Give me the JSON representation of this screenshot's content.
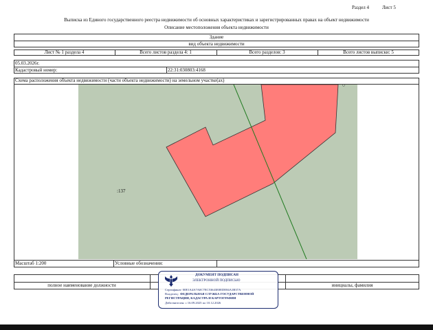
{
  "header": {
    "section": "Раздел 4",
    "sheet": "Лист 5",
    "title": "Выписка из Единого государственного реестра недвижимости об основных характеристиках и зарегистрированных правах на объект недвижимости",
    "subtitle": "Описание местоположения объекта недвижимости"
  },
  "object": {
    "type": "Здание",
    "type_caption": "вид объекта недвижимости"
  },
  "info_row": {
    "sheet_in_section": "Лист № 1 раздела 4",
    "total_sheets_section": "Всего листов раздела 4: 1",
    "total_sections": "Всего разделов: 3",
    "total_sheets_extract": "Всего листов выписки: 5"
  },
  "date": "05.03.2026г.",
  "cadastral": {
    "label": "Кадастровый номер:",
    "value": "22:31:030803:4168"
  },
  "scheme": {
    "title": "Схема расположения объекта недвижимости (части объекта недвижимости) на земельном участке(ах)",
    "parcel_label": ":137",
    "colors": {
      "parcel": "#bccbb5",
      "building": "#ff7d7a",
      "outline": "#333333",
      "line": "#1f7a1f"
    }
  },
  "footer": {
    "scale": "Масштаб 1:200",
    "legend": "Условные обозначения:",
    "position_label": "полное наименование должности",
    "initials_label": "инициалы, фамилия"
  },
  "stamp": {
    "line1": "ДОКУМЕНТ ПОДПИСАН",
    "line2": "ЭЛЕКТРОННОЙ ПОДПИСЬЮ",
    "cert": "Сертификат: 00E1A4A7A0C7EC53643E0EDE84A1B37A",
    "owner_label": "Владелец:",
    "owner": "ФЕДЕРАЛЬНАЯ СЛУЖБА ГОСУДАРСТВЕННОЙ",
    "owner2": "РЕГИСТРАЦИИ, КАДАСТРА И КАРТОГРАФИИ",
    "valid": "Действителен: с 16.09.2025 по 10.12.2026"
  }
}
